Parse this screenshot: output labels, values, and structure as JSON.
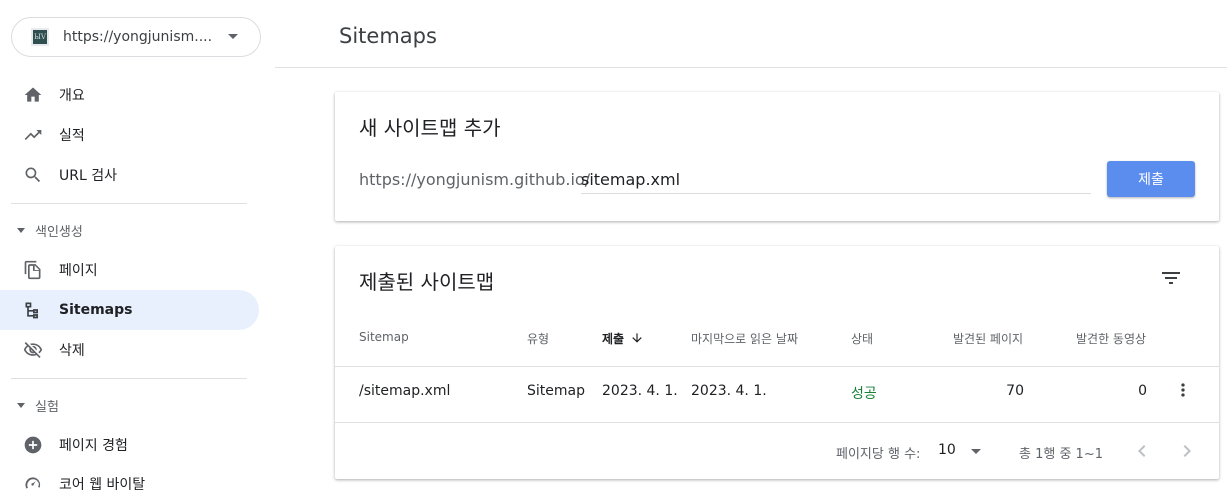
{
  "sidebar": {
    "property_url": "https://yongjunism....",
    "property_logo_text": "ЫV",
    "items": [
      {
        "label": "개요",
        "icon": "home-icon"
      },
      {
        "label": "실적",
        "icon": "trending-up-icon"
      },
      {
        "label": "URL 검사",
        "icon": "search-icon"
      }
    ],
    "section_indexing": "색인생성",
    "indexing_items": [
      {
        "label": "페이지",
        "icon": "pages-icon"
      },
      {
        "label": "Sitemaps",
        "icon": "sitemap-icon",
        "active": true
      },
      {
        "label": "삭제",
        "icon": "visibility-off-icon"
      }
    ],
    "section_experience": "실험",
    "experience_items": [
      {
        "label": "페이지 경험",
        "icon": "plus-circle-icon"
      },
      {
        "label": "코어 웹 바이탈",
        "icon": "speedometer-icon"
      }
    ]
  },
  "header": {
    "title": "Sitemaps"
  },
  "add_card": {
    "title": "새 사이트맵 추가",
    "prefix": "https://yongjunism.github.io/",
    "input_value": "sitemap.xml",
    "submit_label": "제출"
  },
  "submitted_card": {
    "title": "제출된 사이트맵",
    "columns": [
      "Sitemap",
      "유형",
      "제출",
      "마지막으로 읽은 날짜",
      "상태",
      "발견된 페이지",
      "발견한 동영상"
    ],
    "sorted_column": "제출",
    "rows": [
      {
        "sitemap": "/sitemap.xml",
        "type": "Sitemap",
        "submitted": "2023. 4. 1.",
        "last_read": "2023. 4. 1.",
        "status": "성공",
        "pages": "70",
        "videos": "0"
      }
    ],
    "footer": {
      "rows_per_page_label": "페이지당 행 수:",
      "rows_per_page_value": "10",
      "range_text": "총 1행 중 1~1"
    }
  },
  "colors": {
    "accent": "#5b8def",
    "active_nav": "#e8f0fe",
    "success": "#188038"
  }
}
